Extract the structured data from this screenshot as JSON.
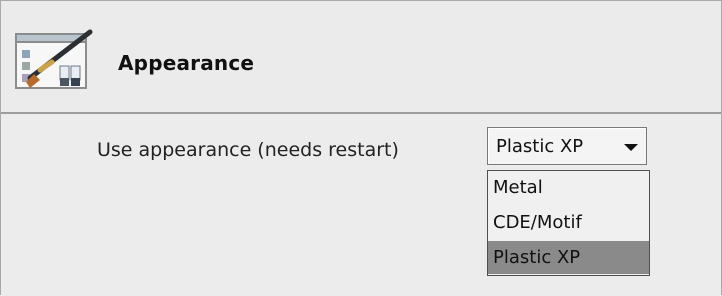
{
  "header": {
    "title": "Appearance",
    "icon": "appearance-settings-icon"
  },
  "setting": {
    "label": "Use appearance (needs restart)",
    "selected": "Plastic XP",
    "options": [
      "Metal",
      "CDE/Motif",
      "Plastic XP"
    ]
  },
  "colors": {
    "background": "#ececec",
    "selection": "#8a8a8a",
    "border": "#9d9d9d"
  }
}
